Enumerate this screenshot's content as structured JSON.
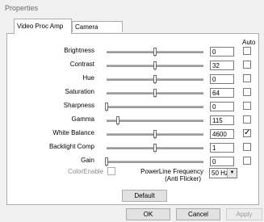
{
  "window": {
    "title": "Properties"
  },
  "tabs": [
    {
      "label": "Video Proc Amp",
      "active": true
    },
    {
      "label": "Camera Control",
      "active": false
    }
  ],
  "columns": {
    "auto_header": "Auto"
  },
  "rows": [
    {
      "label": "Brightness",
      "value": "0",
      "position": 0.5,
      "auto": false,
      "enabled": true
    },
    {
      "label": "Contrast",
      "value": "32",
      "position": 0.5,
      "auto": false,
      "enabled": true
    },
    {
      "label": "Hue",
      "value": "0",
      "position": 0.5,
      "auto": false,
      "enabled": true
    },
    {
      "label": "Saturation",
      "value": "64",
      "position": 0.5,
      "auto": false,
      "enabled": true
    },
    {
      "label": "Sharpness",
      "value": "0",
      "position": 0.0,
      "auto": false,
      "enabled": true
    },
    {
      "label": "Gamma",
      "value": "115",
      "position": 0.12,
      "auto": false,
      "enabled": true
    },
    {
      "label": "White Balance",
      "value": "4600",
      "position": 0.5,
      "auto": true,
      "enabled": true
    },
    {
      "label": "Backlight Comp",
      "value": "1",
      "position": 0.5,
      "auto": false,
      "enabled": true
    },
    {
      "label": "Gain",
      "value": "0",
      "position": 0.0,
      "auto": false,
      "enabled": true
    }
  ],
  "colorenable": {
    "label": "ColorEnable",
    "checked": false,
    "enabled": false
  },
  "powerline": {
    "label_line1": "PowerLine Frequency",
    "label_line2": "(Anti Flicker)",
    "selected": "50 Hz"
  },
  "buttons": {
    "default": "Default",
    "ok": "OK",
    "cancel": "Cancel",
    "apply": "Apply"
  },
  "icons": {
    "dropdown": "chevron-down-icon",
    "checkmark": "check-icon"
  }
}
